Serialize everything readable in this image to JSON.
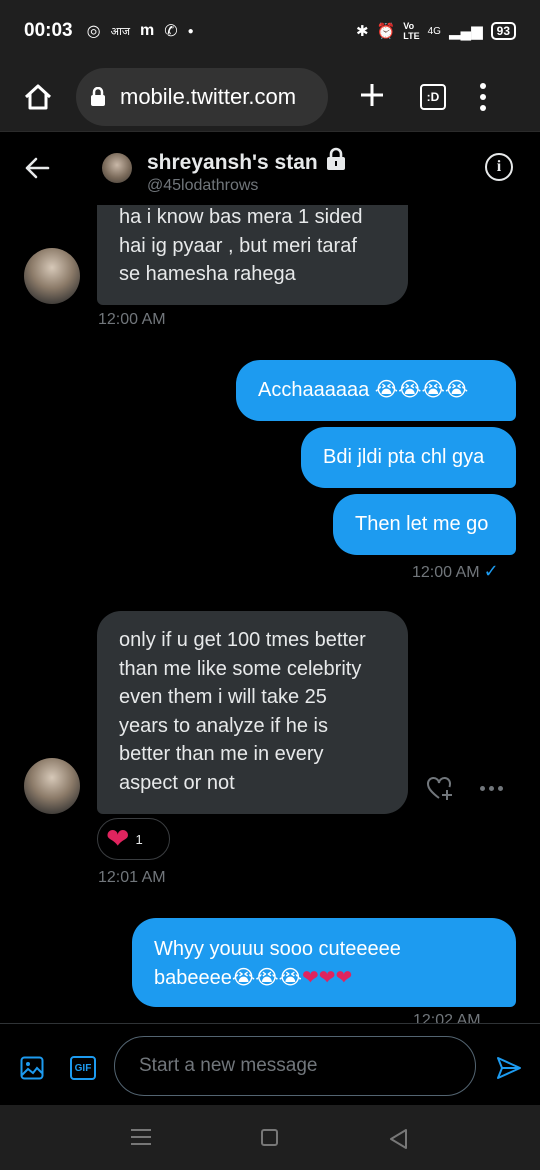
{
  "status_bar": {
    "time": "00:03",
    "icons": [
      "whatsapp-icon",
      "ajtak-icon",
      "m-icon",
      "phone-icon",
      "dot-icon"
    ],
    "right_icons": [
      "bluetooth-icon",
      "alarm-icon",
      "volte-icon",
      "signal-icon"
    ],
    "network": "4G",
    "battery": "93"
  },
  "browser": {
    "url": "mobile.twitter.com",
    "tabs_label": ":D"
  },
  "conversation": {
    "name": "shreyansh's stan",
    "handle": "@45lodathrows"
  },
  "messages": {
    "m1": {
      "line1": "ha i know bas mera 1 sided",
      "line2": "hai ig pyaar , but meri taraf",
      "line3": "se hamesha rahega",
      "time": "12:00 AM"
    },
    "m2": {
      "text": "Acchaaaaaa 😭😭😭😭"
    },
    "m3": {
      "text": "Bdi jldi pta chl gya"
    },
    "m4": {
      "text": "Then let me go",
      "time": "12:00 AM",
      "check": "✓"
    },
    "m5": {
      "line1": "only if u get 100 tmes better",
      "line2": "than me like some celebrity",
      "line3": "even them i will take 25",
      "line4": "years to analyze if he is",
      "line5": "better than me in every",
      "line6": "aspect or not",
      "reaction": "❤",
      "reaction_count": "1",
      "time": "12:01 AM"
    },
    "m6": {
      "line1": "Whyy youuu sooo cuteeeee",
      "line2_text": "babeeee😭😭😭",
      "hearts": "❤❤❤",
      "time": "12:02 AM"
    }
  },
  "composer": {
    "placeholder": "Start a new message",
    "gif_label": "GIF"
  },
  "colors": {
    "accent": "#1d9bf0",
    "received_bubble": "#2f3336",
    "heart": "#e0245e"
  }
}
